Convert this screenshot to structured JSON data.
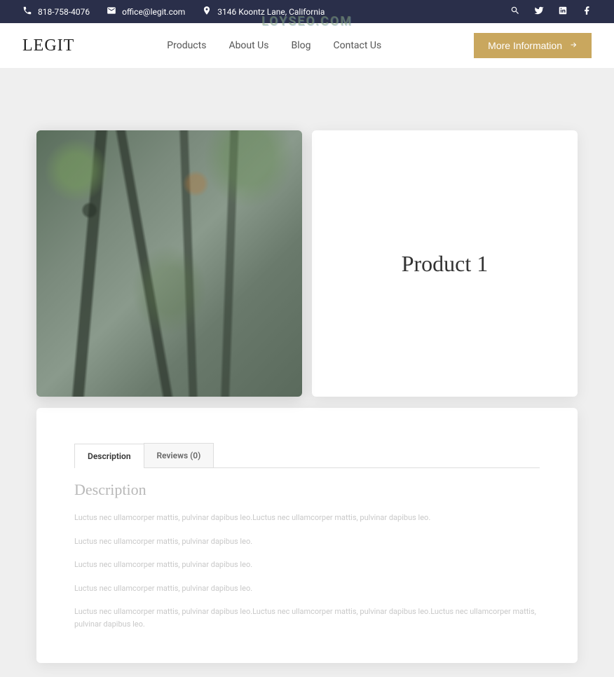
{
  "watermark": "LOYSEO.COM",
  "topbar": {
    "phone": "818-758-4076",
    "email": "office@legit.com",
    "address": "3146 Koontz Lane, California"
  },
  "navbar": {
    "logo": "LEGIT",
    "menu": [
      "Products",
      "About Us",
      "Blog",
      "Contact Us"
    ],
    "cta": "More Information"
  },
  "product": {
    "title": "Product 1"
  },
  "tabs": {
    "items": [
      "Description",
      "Reviews (0)"
    ],
    "active": 0
  },
  "description": {
    "heading": "Description",
    "paras": [
      "Luctus nec ullamcorper mattis, pulvinar dapibus leo.Luctus nec ullamcorper mattis, pulvinar dapibus leo.",
      "Luctus nec ullamcorper mattis, pulvinar dapibus leo.",
      "Luctus nec ullamcorper mattis, pulvinar dapibus leo.",
      "Luctus nec ullamcorper mattis, pulvinar dapibus leo.",
      "Luctus nec ullamcorper mattis, pulvinar dapibus leo.Luctus nec ullamcorper mattis, pulvinar dapibus leo.Luctus nec ullamcorper mattis, pulvinar dapibus leo."
    ]
  }
}
